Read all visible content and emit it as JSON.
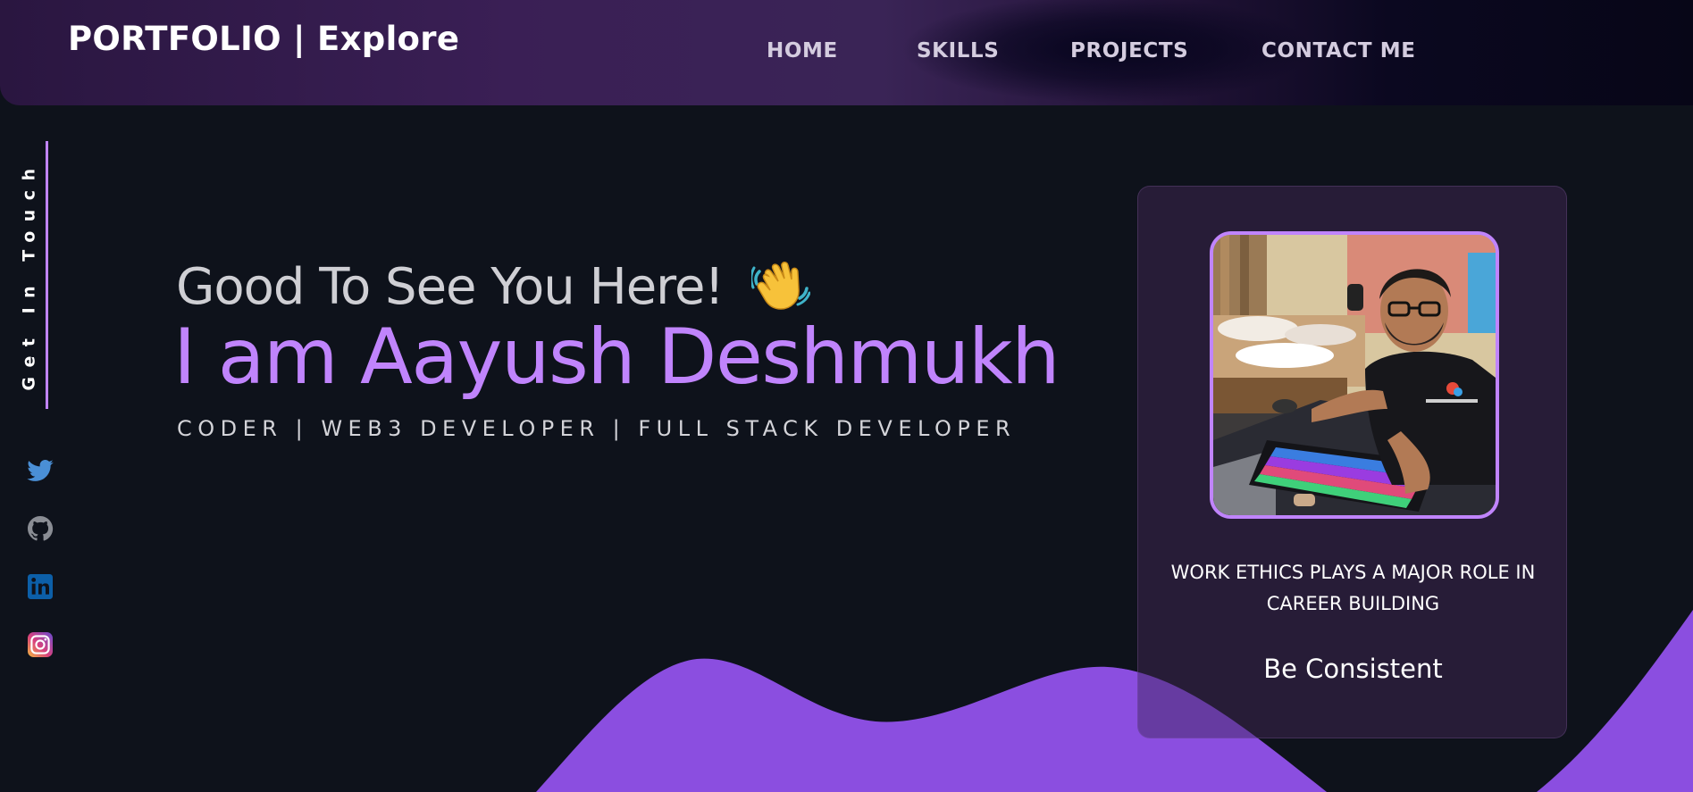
{
  "navbar": {
    "brand": "PORTFOLIO | Explore",
    "links": [
      "HOME",
      "SKILLS",
      "PROJECTS",
      "CONTACT ME"
    ]
  },
  "sidebar": {
    "get_in_touch": "Get In Touch",
    "socials": [
      "twitter-icon",
      "github-icon",
      "linkedin-icon",
      "instagram-icon"
    ]
  },
  "hero": {
    "greeting": "Good To See You Here!",
    "name": "I am Aayush Deshmukh",
    "roles": "CODER | WEB3 DEVELOPER | FULL STACK DEVELOPER"
  },
  "card": {
    "quote": "WORK ETHICS PLAYS A MAJOR ROLE IN CAREER BUILDING",
    "motto": "Be Consistent"
  },
  "colors": {
    "accent": "#c084fc",
    "wave": "#8b4ee0",
    "background": "#0e121b",
    "card": "#2b1e3c"
  }
}
